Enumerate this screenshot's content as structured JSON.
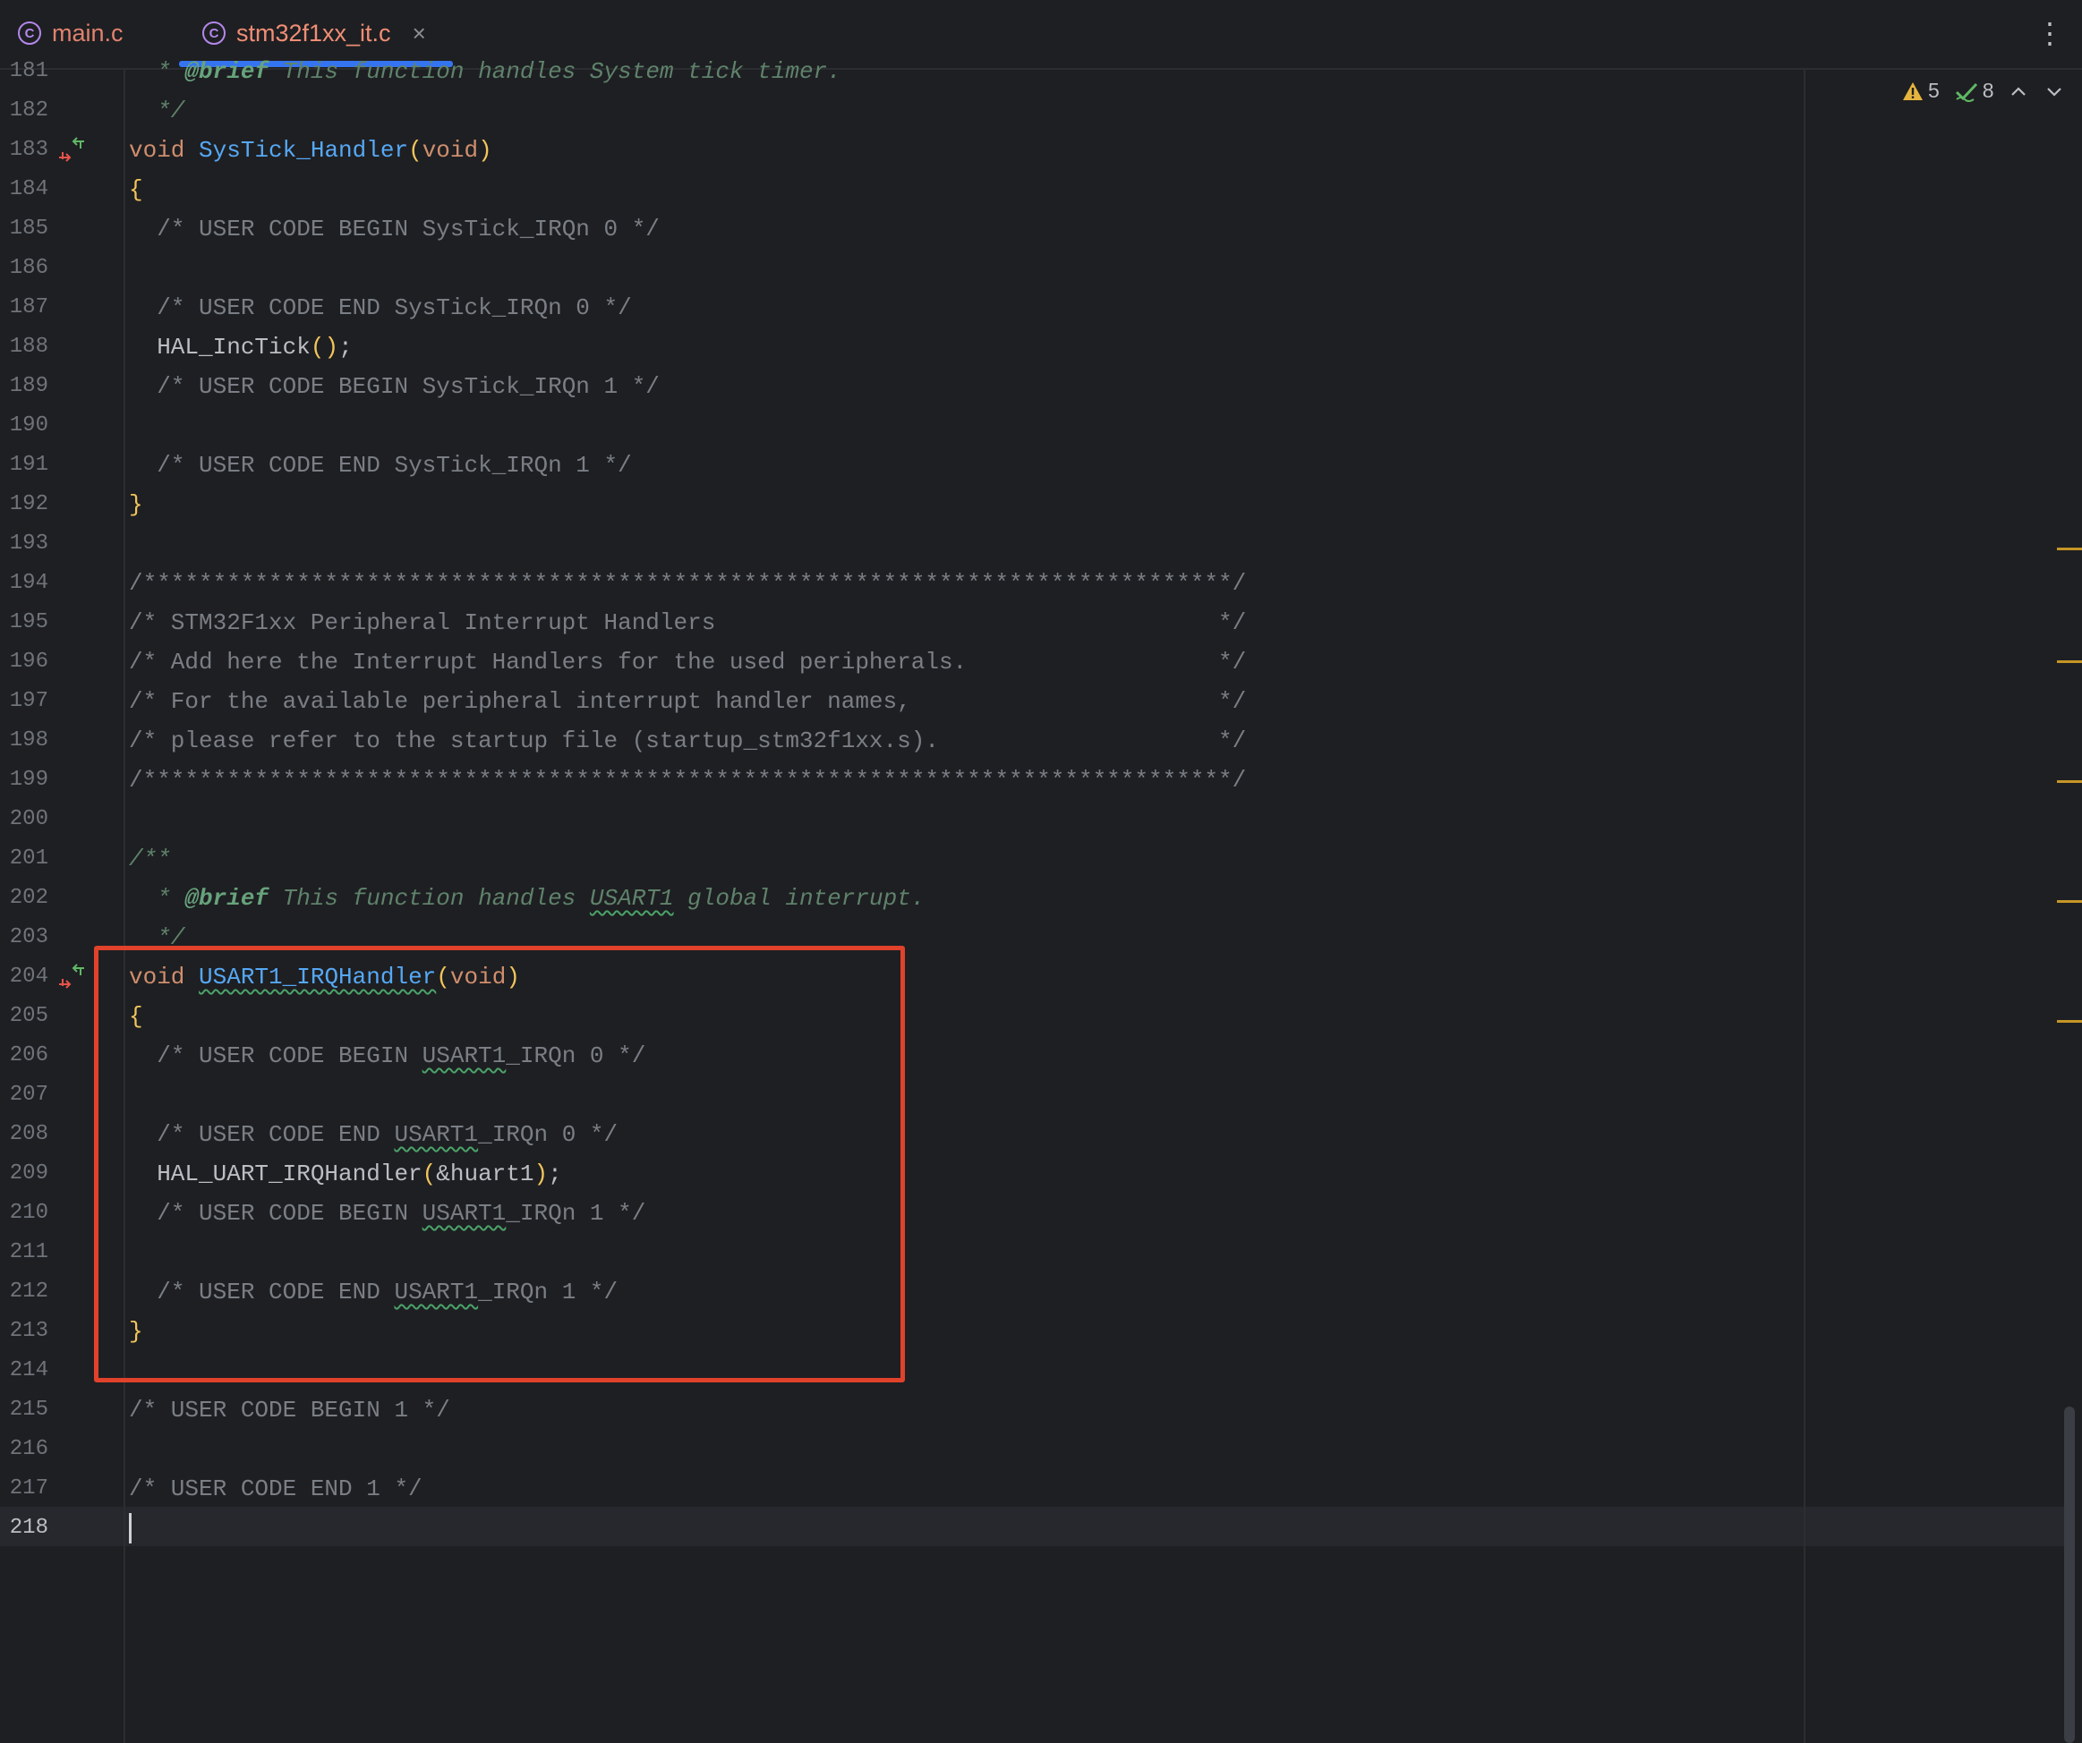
{
  "tabs": [
    {
      "label": "main.c",
      "icon": "c-file-icon",
      "active": false
    },
    {
      "label": "stm32f1xx_it.c",
      "icon": "c-file-icon",
      "active": true,
      "close": "×"
    }
  ],
  "menu": "⋮",
  "inspections": {
    "warnings": "5",
    "weak_warnings": "8"
  },
  "colors": {
    "accent": "#3574f0",
    "highlight_box": "#e0422b",
    "keyword": "#cf8e6d",
    "function": "#56a8f5",
    "comment": "#7a7e85"
  },
  "lines": [
    {
      "n": "181",
      "html": "<span class='doc'>  * </span><span class='doctag'>@brief</span><span class='doc'> This function handles System tick timer.</span>"
    },
    {
      "n": "182",
      "html": "<span class='doc'>  */</span>"
    },
    {
      "n": "183",
      "impl": true,
      "html": "<span class='kw'>void</span> <span class='fn'>SysTick_Handler</span><span class='br'>(</span><span class='kw'>void</span><span class='br'>)</span>"
    },
    {
      "n": "184",
      "html": "<span class='br'>{</span>"
    },
    {
      "n": "185",
      "html": "  <span class='cm'>/* USER CODE BEGIN SysTick_IRQn 0 */</span>"
    },
    {
      "n": "186",
      "html": ""
    },
    {
      "n": "187",
      "html": "  <span class='cm'>/* USER CODE END SysTick_IRQn 0 */</span>"
    },
    {
      "n": "188",
      "html": "  HAL_IncTick<span class='br'>()</span>;"
    },
    {
      "n": "189",
      "html": "  <span class='cm'>/* USER CODE BEGIN SysTick_IRQn 1 */</span>"
    },
    {
      "n": "190",
      "html": ""
    },
    {
      "n": "191",
      "html": "  <span class='cm'>/* USER CODE END SysTick_IRQn 1 */</span>"
    },
    {
      "n": "192",
      "html": "<span class='br'>}</span>"
    },
    {
      "n": "193",
      "html": ""
    },
    {
      "n": "194",
      "html": "<span class='cm'>/******************************************************************************/</span>"
    },
    {
      "n": "195",
      "html": "<span class='cm'>/* STM32F1xx Peripheral Interrupt Handlers                                    */</span>"
    },
    {
      "n": "196",
      "html": "<span class='cm'>/* Add here the Interrupt Handlers for the used peripherals.                  */</span>"
    },
    {
      "n": "197",
      "html": "<span class='cm'>/* For the available peripheral interrupt handler names,                      */</span>"
    },
    {
      "n": "198",
      "html": "<span class='cm'>/* please refer to the startup file (startup_stm32f1xx.s).                    */</span>"
    },
    {
      "n": "199",
      "html": "<span class='cm'>/******************************************************************************/</span>"
    },
    {
      "n": "200",
      "html": ""
    },
    {
      "n": "201",
      "html": "<span class='doc'>/**</span>"
    },
    {
      "n": "202",
      "html": "<span class='doc'>  * </span><span class='doctag'>@brief</span><span class='doc'> This function handles <span class='ws'>USART1</span> global interrupt.</span>"
    },
    {
      "n": "203",
      "html": "<span class='doc'>  */</span>"
    },
    {
      "n": "204",
      "impl": true,
      "html": "<span class='kw'>void</span> <span class='fn ws'>USART1_IRQHandler</span><span class='br'>(</span><span class='kw'>void</span><span class='br'>)</span>"
    },
    {
      "n": "205",
      "html": "<span class='br'>{</span>"
    },
    {
      "n": "206",
      "html": "  <span class='cm'>/* USER CODE BEGIN <span class='ws'>USART1</span>_IRQn 0 */</span>"
    },
    {
      "n": "207",
      "html": ""
    },
    {
      "n": "208",
      "html": "  <span class='cm'>/* USER CODE END <span class='ws'>USART1</span>_IRQn 0 */</span>"
    },
    {
      "n": "209",
      "html": "  HAL_UART_IRQHandler<span class='br'>(</span>&amp;huart1<span class='br'>)</span>;"
    },
    {
      "n": "210",
      "html": "  <span class='cm'>/* USER CODE BEGIN <span class='ws'>USART1</span>_IRQn 1 */</span>"
    },
    {
      "n": "211",
      "html": ""
    },
    {
      "n": "212",
      "html": "  <span class='cm'>/* USER CODE END <span class='ws'>USART1</span>_IRQn 1 */</span>"
    },
    {
      "n": "213",
      "html": "<span class='br'>}</span>"
    },
    {
      "n": "214",
      "html": ""
    },
    {
      "n": "215",
      "html": "<span class='cm'>/* USER CODE BEGIN 1 */</span>"
    },
    {
      "n": "216",
      "html": ""
    },
    {
      "n": "217",
      "html": "<span class='cm'>/* USER CODE END 1 */</span>"
    },
    {
      "n": "218",
      "current": true,
      "html": "<span class='cursor'></span>"
    }
  ]
}
